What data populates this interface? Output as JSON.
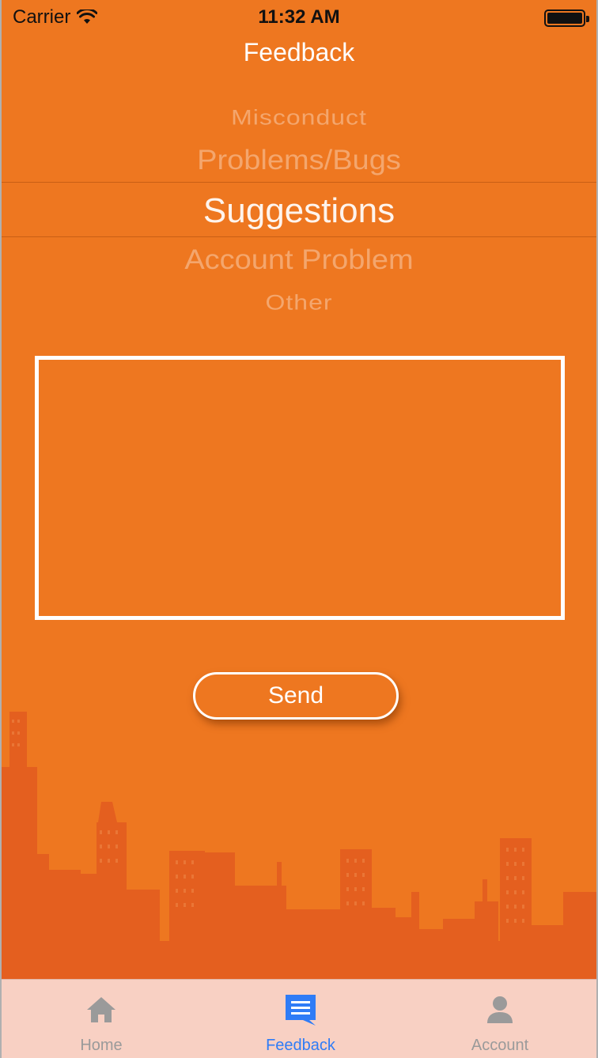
{
  "status_bar": {
    "carrier": "Carrier",
    "time": "11:32 AM",
    "icons": [
      "wifi-icon",
      "battery-icon"
    ]
  },
  "nav": {
    "title": "Feedback"
  },
  "picker": {
    "items": [
      "Misconduct",
      "Problems/Bugs",
      "Suggestions",
      "Account Problem",
      "Other"
    ],
    "selected": "Suggestions"
  },
  "feedback_input": {
    "value": "",
    "placeholder": ""
  },
  "send_button": {
    "label": "Send"
  },
  "tab_bar": {
    "tabs": [
      {
        "label": "Home",
        "icon": "home-icon",
        "active": false
      },
      {
        "label": "Feedback",
        "icon": "feedback-icon",
        "active": true
      },
      {
        "label": "Account",
        "icon": "account-icon",
        "active": false
      }
    ]
  },
  "colors": {
    "background": "#ee7720",
    "skyline": "#e45f1f",
    "tab_bar": "#f8d0c3",
    "active_tab": "#2f7cf6",
    "inactive_tab": "#9a9a9a"
  }
}
